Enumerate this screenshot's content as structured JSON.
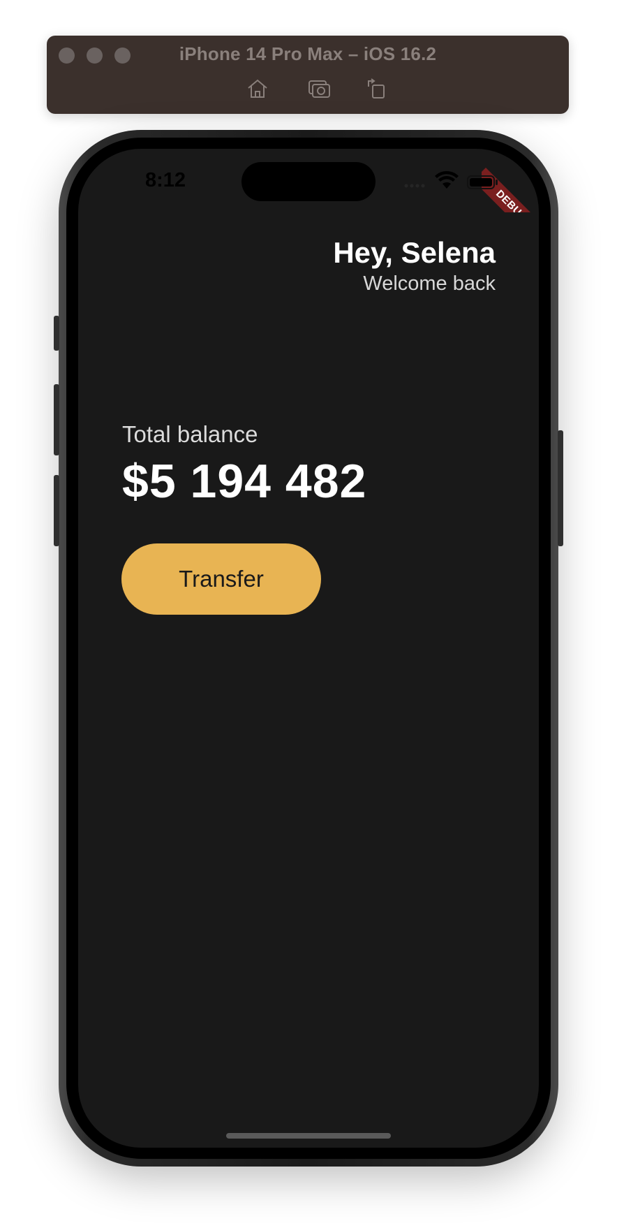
{
  "simulator": {
    "title": "iPhone 14 Pro Max – iOS 16.2",
    "toolbar_icons": [
      "home-icon",
      "screenshot-icon",
      "rotate-icon"
    ]
  },
  "status_bar": {
    "time": "8:12"
  },
  "debug_banner": "DEBUG",
  "header": {
    "greeting": "Hey, Selena",
    "subtitle": "Welcome back"
  },
  "balance": {
    "label": "Total balance",
    "value": "$5 194 482"
  },
  "actions": {
    "transfer_label": "Transfer"
  },
  "colors": {
    "background": "#191919",
    "accent": "#e8b453",
    "debug": "#7a1f1f"
  }
}
